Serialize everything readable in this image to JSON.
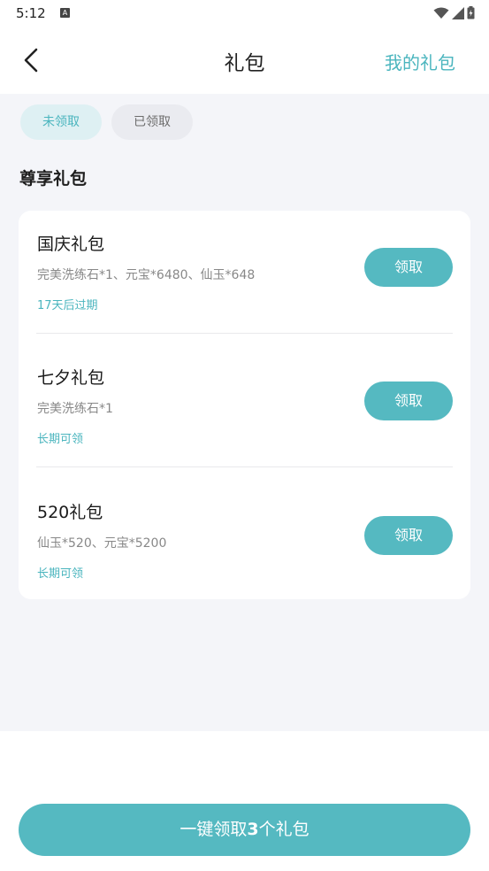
{
  "status_bar": {
    "time": "5:12",
    "notification_icon_letter": "A",
    "icons": [
      "wifi-icon",
      "signal-icon",
      "battery-icon"
    ]
  },
  "header": {
    "title": "礼包",
    "back_icon": "chevron-left-icon",
    "my_gifts_label": "我的礼包"
  },
  "tabs": [
    {
      "label": "未领取",
      "active": true
    },
    {
      "label": "已领取",
      "active": false
    }
  ],
  "section": {
    "title": "尊享礼包"
  },
  "gifts": [
    {
      "name": "国庆礼包",
      "contents": "完美洗练石*1、元宝*6480、仙玉*648",
      "expiry": "17天后过期",
      "button_label": "领取"
    },
    {
      "name": "七夕礼包",
      "contents": "完美洗练石*1",
      "expiry": "长期可领",
      "button_label": "领取"
    },
    {
      "name": "520礼包",
      "contents": "仙玉*520、元宝*5200",
      "expiry": "长期可领",
      "button_label": "领取"
    }
  ],
  "bottom_button": {
    "prefix": "一键领取",
    "count": "3",
    "suffix": "个礼包"
  },
  "colors": {
    "accent": "#55b9c1",
    "accent_text": "#4ab5be",
    "page_background": "#f4f5f9",
    "tab_active_bg": "#def0f3",
    "tab_inactive_bg": "#eaebf0"
  }
}
